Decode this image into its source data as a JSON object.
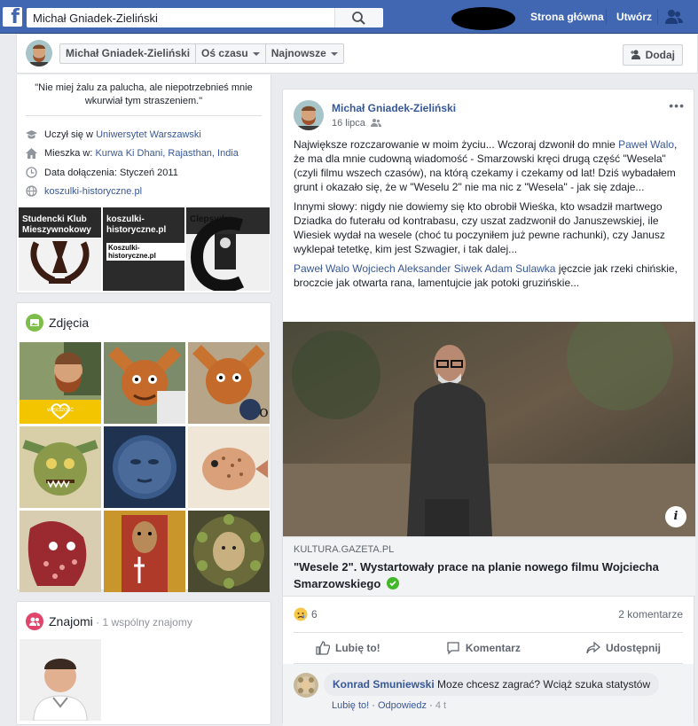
{
  "topbar": {
    "search_value": "Michał Gniadek-Zieliński",
    "nav_home": "Strona główna",
    "nav_create": "Utwórz",
    "brand_color": "#4267b2"
  },
  "profile_bar": {
    "name": "Michał Gniadek-Zieliński",
    "timeline": "Oś czasu",
    "sort": "Najnowsze",
    "add": "Dodaj"
  },
  "intro": {
    "quote": "\"Nie miej żalu za palucha, ale niepotrzebnieś mnie wkurwiał tym straszeniem.\"",
    "studied_prefix": "Uczył się w ",
    "studied_link": "Uniwersytet Warszawski",
    "lives_prefix": "Mieszka w: ",
    "lives_link": "Kurwa Ki Dhani, Rajasthan, India",
    "joined": "Data dołączenia: Styczeń 2011",
    "website": "koszulki-historyczne.pl",
    "featured": [
      {
        "label": "Studencki Klub Mieszywnokowy"
      },
      {
        "label": "koszulki-historyczne.pl",
        "badge": "Koszulki-historyczne.pl"
      },
      {
        "label": "Clepsydra"
      }
    ]
  },
  "photos": {
    "title": "Zdjęcia",
    "icon": "photo-icon",
    "overlay_text": "WIĘKSZOŚĆ"
  },
  "friends": {
    "title": "Znajomi",
    "mutual": " · 1 wspólny znajomy"
  },
  "post": {
    "author": "Michał Gniadek-Zieliński",
    "date": "16 lipca",
    "p1_a": "Największe rozczarowanie w moim życiu... Wczoraj dzwonił do mnie ",
    "p1_link": "Paweł Walo",
    "p1_b": ", że ma dla mnie cudowną wiadomość - Smarzowski kręci drugą część \"Wesela\" (czyli filmu wszech czasów), na którą czekamy i czekamy od lat! Dziś wybadałem grunt i okazało się, że w \"Weselu 2\" nie ma nic z \"Wesela\" - jak się zdaje...",
    "p2": "Innymi słowy: nigdy nie dowiemy się kto obrobił Wieśka, kto wsadził martwego Dziadka do futerału od kontrabasu, czy uszat zadzwonił do Januszewskiej, ile Wiesiek wydał na wesele (choć tu poczyniłem już pewne rachunki), czy Janusz wyklepał tetetkę, kim jest Szwagier, i tak dalej...",
    "p3_links": "Paweł Walo Wojciech Aleksander Siwek Adam Sulawka",
    "p3_b": " jęczcie jak rzeki chińskie, broczcie jak otwarta rana, lamentujcie jak potoki gruzińskie...",
    "link_domain": "KULTURA.GAZETA.PL",
    "link_title": "\"Wesele 2\". Wystartowały prace na planie nowego filmu Wojciecha Smarzowskiego",
    "reaction_count": "6",
    "comment_count": "2 komentarze",
    "like": "Lubię to!",
    "comment": "Komentarz",
    "share": "Udostępnij",
    "info": "i"
  },
  "comment": {
    "author": "Konrad Smuniewski",
    "text": " Moze chcesz zagrać? Wciąż szuka statystów",
    "like": "Lubię to!",
    "reply": "Odpowiedz",
    "time": "4 t"
  }
}
